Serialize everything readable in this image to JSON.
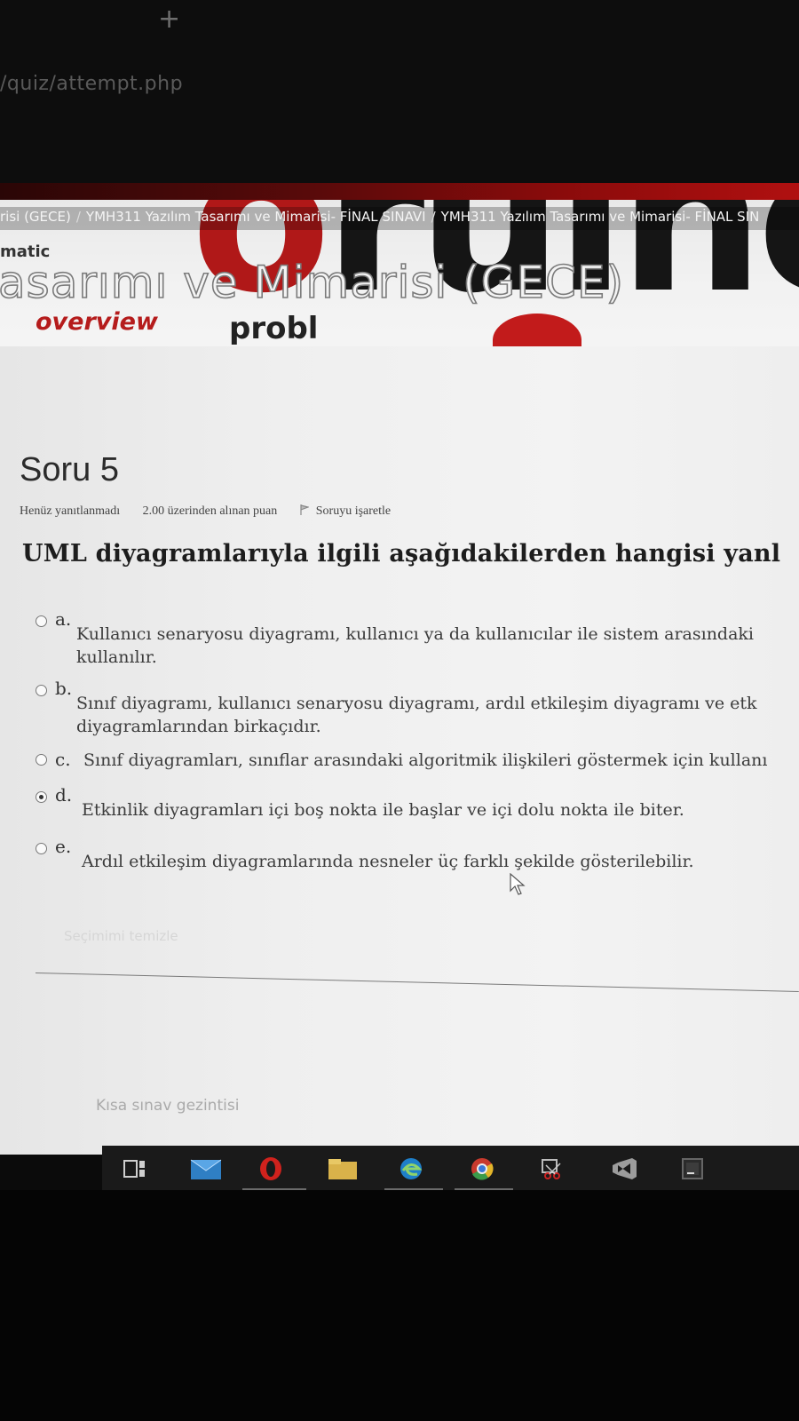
{
  "browser": {
    "new_tab_symbol": "+",
    "url": "/quiz/attempt.php"
  },
  "banner": {
    "breadcrumb": [
      "risi (GECE)",
      "YMH311 Yazılım Tasarımı ve Mimarisi- FİNAL SINAVI",
      "YMH311 Yazılım Tasarımı ve Mimarisi- FİNAL SIN"
    ],
    "breadcrumb_separator": "/",
    "course_title": "asarımı ve Mimarisi (GECE)",
    "word_overview": "overview",
    "word_problem": "probl",
    "small_text": "matic"
  },
  "question": {
    "number_label": "Soru 5",
    "status": "Henüz yanıtlanmadı",
    "points": "2.00 üzerinden alınan puan",
    "flag_label": "Soruyu işaretle",
    "text": "UML diyagramlarıyla ilgili aşağıdakilerden hangisi yanl",
    "answers": [
      {
        "letter": "a.",
        "lines": [
          "Kullanıcı senaryosu diyagramı, kullanıcı ya da kullanıcılar ile sistem arasındaki",
          "kullanılır."
        ],
        "selected": false
      },
      {
        "letter": "b.",
        "lines": [
          "Sınıf diyagramı, kullanıcı senaryosu diyagramı, ardıl etkileşim diyagramı ve etk",
          "diyagramlarından birkaçıdır."
        ],
        "selected": false
      },
      {
        "letter": "c.",
        "lines": [
          "Sınıf diyagramları, sınıflar arasındaki algoritmik ilişkileri göstermek için kullanı"
        ],
        "selected": false
      },
      {
        "letter": "d.",
        "lines": [
          "Etkinlik diyagramları içi boş nokta ile başlar ve içi dolu nokta ile biter."
        ],
        "selected": true
      },
      {
        "letter": "e.",
        "lines": [
          "Ardıl etkileşim diyagramlarında nesneler üç farklı şekilde gösterilebilir."
        ],
        "selected": false
      }
    ],
    "clear_choice": "Seçimimi temizle"
  },
  "quiz_navigation": "Kısa sınav gezintisi",
  "taskbar_icons": [
    "task-view-icon",
    "mail-icon",
    "opera-icon",
    "file-explorer-icon",
    "edge-icon",
    "chrome-icon",
    "snipping-tool-icon",
    "visual-studio-icon",
    "intellij-icon"
  ],
  "colors": {
    "brand_red": "#b01818",
    "page_bg": "#f0f0f0",
    "taskbar_bg": "#1a1a1a"
  }
}
